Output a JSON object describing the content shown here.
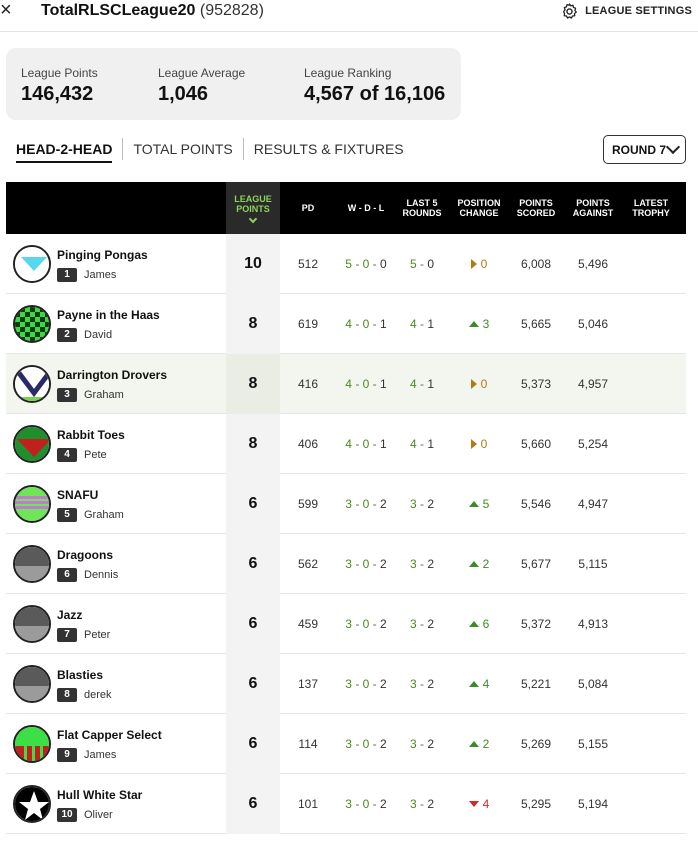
{
  "header": {
    "close_icon": "×",
    "league_name": "TotalRLSCLeague20",
    "league_id": "(952828)",
    "settings_label": "LEAGUE SETTINGS"
  },
  "stats": [
    {
      "label": "League Points",
      "value": "146,432"
    },
    {
      "label": "League Average",
      "value": "1,046"
    },
    {
      "label": "League Ranking",
      "value": "4,567 of 16,106"
    }
  ],
  "tabs": [
    {
      "label": "HEAD-2-HEAD",
      "active": true
    },
    {
      "label": "TOTAL POINTS",
      "active": false
    },
    {
      "label": "RESULTS & FIXTURES",
      "active": false
    }
  ],
  "round_select": {
    "value": "ROUND 7"
  },
  "columns": {
    "league_points": [
      "LEAGUE",
      "POINTS"
    ],
    "pd": "PD",
    "wdl": "W - D - L",
    "last5": [
      "LAST 5",
      "ROUNDS"
    ],
    "position": [
      "POSITION",
      "CHANGE"
    ],
    "scored": [
      "POINTS",
      "SCORED"
    ],
    "against": [
      "POINTS",
      "AGAINST"
    ],
    "trophy": [
      "LATEST",
      "TROPHY"
    ]
  },
  "rows": [
    {
      "team": "Pinging Pongas",
      "rank": "1",
      "coach": "James",
      "lp": "10",
      "pd": "512",
      "w": "5",
      "d": "0",
      "l": "0",
      "l5w": "5",
      "l5l": "0",
      "dir": "same",
      "pos": "0",
      "scored": "6,008",
      "against": "5,496",
      "jersey": "pongas"
    },
    {
      "team": "Payne in the Haas",
      "rank": "2",
      "coach": "David",
      "lp": "8",
      "pd": "619",
      "w": "4",
      "d": "0",
      "l": "1",
      "l5w": "4",
      "l5l": "1",
      "dir": "up",
      "pos": "3",
      "scored": "5,665",
      "against": "5,046",
      "jersey": "checker"
    },
    {
      "team": "Darrington Drovers",
      "rank": "3",
      "coach": "Graham",
      "lp": "8",
      "pd": "416",
      "w": "4",
      "d": "0",
      "l": "1",
      "l5w": "4",
      "l5l": "1",
      "dir": "same",
      "pos": "0",
      "scored": "5,373",
      "against": "4,957",
      "jersey": "drovers"
    },
    {
      "team": "Rabbit Toes",
      "rank": "4",
      "coach": "Pete",
      "lp": "8",
      "pd": "406",
      "w": "4",
      "d": "0",
      "l": "1",
      "l5w": "4",
      "l5l": "1",
      "dir": "same",
      "pos": "0",
      "scored": "5,660",
      "against": "5,254",
      "jersey": "rabbit"
    },
    {
      "team": "SNAFU",
      "rank": "5",
      "coach": "Graham",
      "lp": "6",
      "pd": "599",
      "w": "3",
      "d": "0",
      "l": "2",
      "l5w": "3",
      "l5l": "2",
      "dir": "up",
      "pos": "5",
      "scored": "5,546",
      "against": "4,947",
      "jersey": "snafu"
    },
    {
      "team": "Dragoons",
      "rank": "6",
      "coach": "Dennis",
      "lp": "6",
      "pd": "562",
      "w": "3",
      "d": "0",
      "l": "2",
      "l5w": "3",
      "l5l": "2",
      "dir": "up",
      "pos": "2",
      "scored": "5,677",
      "against": "5,115",
      "jersey": "grey"
    },
    {
      "team": "Jazz",
      "rank": "7",
      "coach": "Peter",
      "lp": "6",
      "pd": "459",
      "w": "3",
      "d": "0",
      "l": "2",
      "l5w": "3",
      "l5l": "2",
      "dir": "up",
      "pos": "6",
      "scored": "5,372",
      "against": "4,913",
      "jersey": "grey"
    },
    {
      "team": "Blasties",
      "rank": "8",
      "coach": "derek",
      "lp": "6",
      "pd": "137",
      "w": "3",
      "d": "0",
      "l": "2",
      "l5w": "3",
      "l5l": "2",
      "dir": "up",
      "pos": "4",
      "scored": "5,221",
      "against": "5,084",
      "jersey": "grey"
    },
    {
      "team": "Flat Capper Select",
      "rank": "9",
      "coach": "James",
      "lp": "6",
      "pd": "114",
      "w": "3",
      "d": "0",
      "l": "2",
      "l5w": "3",
      "l5l": "2",
      "dir": "up",
      "pos": "2",
      "scored": "5,269",
      "against": "5,155",
      "jersey": "flatcap"
    },
    {
      "team": "Hull White Star",
      "rank": "10",
      "coach": "Oliver",
      "lp": "6",
      "pd": "101",
      "w": "3",
      "d": "0",
      "l": "2",
      "l5w": "3",
      "l5l": "2",
      "dir": "down",
      "pos": "4",
      "scored": "5,295",
      "against": "5,194",
      "jersey": "star"
    }
  ]
}
